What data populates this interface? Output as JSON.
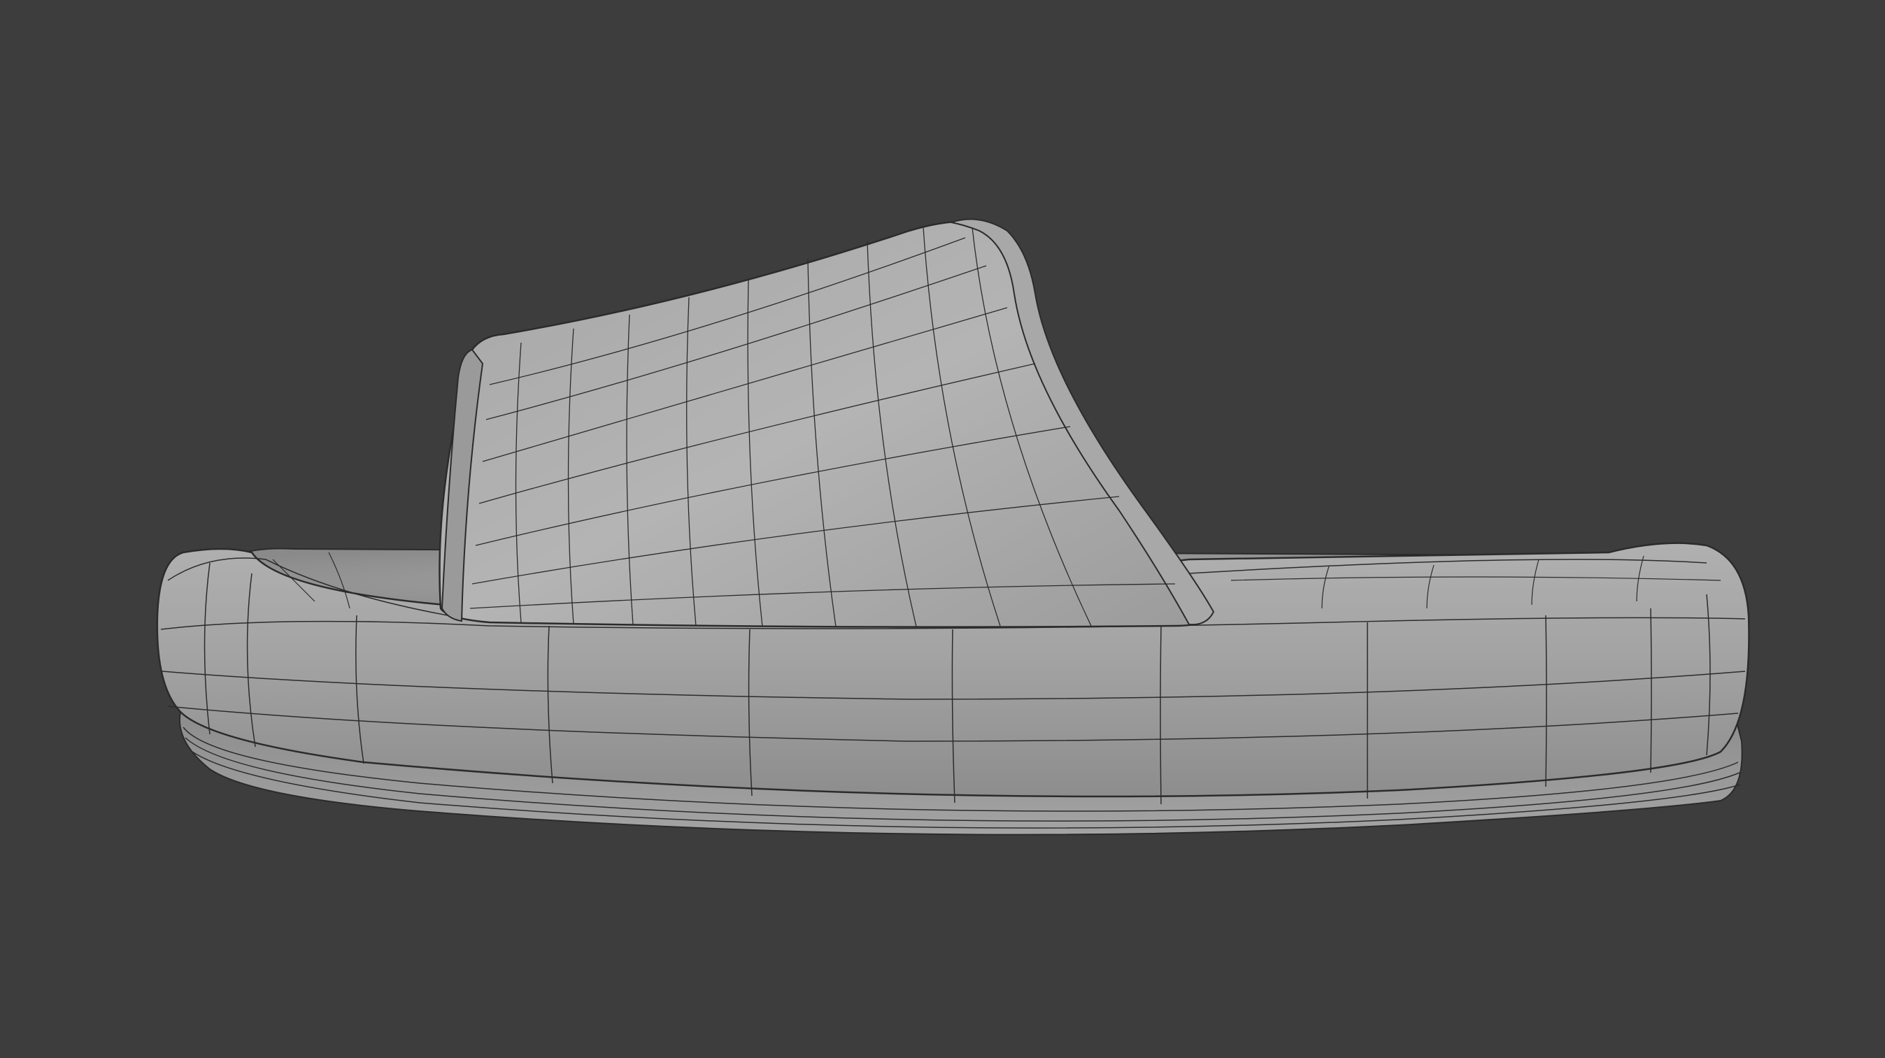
{
  "viewport": {
    "background_color": "#3d3d3d",
    "shading": "solid",
    "overlay": "wireframe"
  },
  "model": {
    "object": "slide-sandal",
    "view": "side",
    "surface_color": "#9a9a9a",
    "highlight_color": "#b4b4b4",
    "shadow_color": "#6e6e6e",
    "wire_color": "#2b2b2b"
  }
}
